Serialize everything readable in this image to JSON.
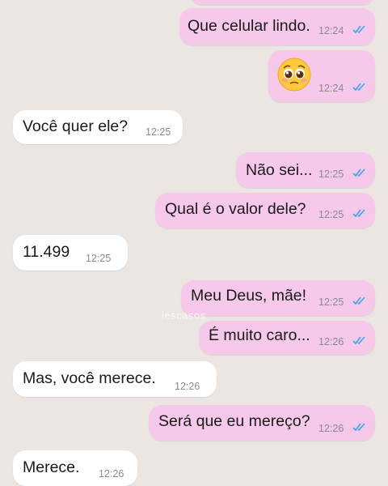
{
  "colors": {
    "background": "#ebe6e2",
    "outgoing_bubble": "#f6c9ea",
    "incoming_bubble": "#ffffff",
    "read_ticks": "#3aa4e6"
  },
  "watermark": "iescasos",
  "messages": [
    {
      "direction": "out",
      "text": "Que celular lindo.",
      "time": "12:24",
      "status": "read"
    },
    {
      "direction": "out",
      "emoji": "pleading-face",
      "time": "12:24",
      "status": "read"
    },
    {
      "direction": "in",
      "text": "Você quer ele?",
      "time": "12:25"
    },
    {
      "direction": "out",
      "text": "Não sei...",
      "time": "12:25",
      "status": "read"
    },
    {
      "direction": "out",
      "text": "Qual é o valor dele?",
      "time": "12:25",
      "status": "read"
    },
    {
      "direction": "in",
      "text": "11.499",
      "time": "12:25"
    },
    {
      "direction": "out",
      "text": "Meu Deus, mãe!",
      "time": "12:25",
      "status": "read"
    },
    {
      "direction": "out",
      "text": "É muito caro...",
      "time": "12:26",
      "status": "read"
    },
    {
      "direction": "in",
      "text": "Mas, você merece.",
      "time": "12:26"
    },
    {
      "direction": "out",
      "text": "Será que eu mereço?",
      "time": "12:26",
      "status": "read"
    },
    {
      "direction": "in",
      "text": "Merece.",
      "time": "12:26"
    }
  ]
}
